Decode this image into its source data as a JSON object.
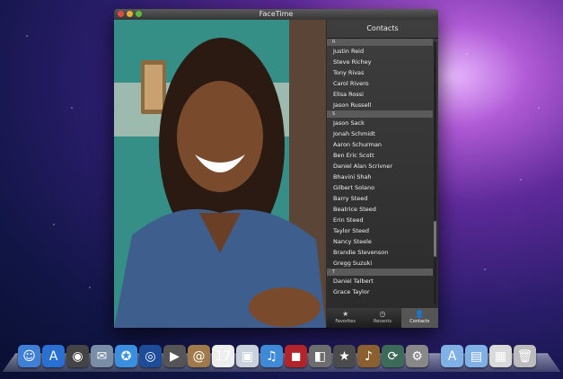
{
  "window": {
    "title": "FaceTime"
  },
  "contacts": {
    "header": "Contacts",
    "sections": [
      {
        "letter": "R",
        "names": [
          "Justin Reid",
          "Steve Richey",
          "Tony Rivas",
          "Carol Rivero",
          "Elisa Rossi",
          "Jason Russell"
        ]
      },
      {
        "letter": "S",
        "names": [
          "Jason Sack",
          "Jonah Schmidt",
          "Aaron Schurman",
          "Ben Eric Scott",
          "Daniel Alan Scrivner",
          "Bhavini Shah",
          "Gilbert Solano",
          "Barry Steed",
          "Beatrice Steed",
          "Erin Steed",
          "Taylor Steed",
          "Nancy Steele",
          "Brandie Stevenson",
          "Gregg Suzuki"
        ]
      },
      {
        "letter": "T",
        "names": [
          "Daniel Talbert",
          "Grace Taylor"
        ]
      }
    ]
  },
  "tabs": [
    {
      "label": "Favorites",
      "icon": "star-icon"
    },
    {
      "label": "Recents",
      "icon": "clock-icon"
    },
    {
      "label": "Contacts",
      "icon": "person-icon"
    }
  ],
  "dock": {
    "apps": [
      {
        "name": "finder-icon",
        "color": "#3f7fd6",
        "glyph": "☺"
      },
      {
        "name": "app-store-icon",
        "color": "#2a6fd3",
        "glyph": "A"
      },
      {
        "name": "dashboard-icon",
        "color": "#444444",
        "glyph": "◉"
      },
      {
        "name": "mail-stamp-icon",
        "color": "#7a8ea8",
        "glyph": "✉"
      },
      {
        "name": "safari-icon",
        "color": "#3a8fe0",
        "glyph": "✪"
      },
      {
        "name": "ichat-icon",
        "color": "#1d4d9a",
        "glyph": "◎"
      },
      {
        "name": "facetime-icon",
        "color": "#555555",
        "glyph": "▶"
      },
      {
        "name": "address-book-icon",
        "color": "#a07a4a",
        "glyph": "@"
      },
      {
        "name": "ical-icon",
        "color": "#eeeeee",
        "glyph": "17"
      },
      {
        "name": "preview-icon",
        "color": "#c9d2dc",
        "glyph": "▣"
      },
      {
        "name": "itunes-icon",
        "color": "#3f8ad6",
        "glyph": "♫"
      },
      {
        "name": "photo-booth-icon",
        "color": "#b3242a",
        "glyph": "◼"
      },
      {
        "name": "iphoto-icon",
        "color": "#6d6d6d",
        "glyph": "◧"
      },
      {
        "name": "imovie-icon",
        "color": "#4b4b4b",
        "glyph": "★"
      },
      {
        "name": "garageband-icon",
        "color": "#8a6030",
        "glyph": "♪"
      },
      {
        "name": "time-machine-icon",
        "color": "#3d6b5a",
        "glyph": "⟳"
      },
      {
        "name": "system-preferences-icon",
        "color": "#888888",
        "glyph": "⚙"
      },
      {
        "name": "applications-folder-icon",
        "color": "#7fb0e6",
        "glyph": "A"
      },
      {
        "name": "documents-folder-icon",
        "color": "#7fb0e6",
        "glyph": "▤"
      },
      {
        "name": "downloads-stack-icon",
        "color": "#d9d9d9",
        "glyph": "▦"
      },
      {
        "name": "trash-icon",
        "color": "#bcbcbc",
        "glyph": "🗑"
      }
    ]
  }
}
